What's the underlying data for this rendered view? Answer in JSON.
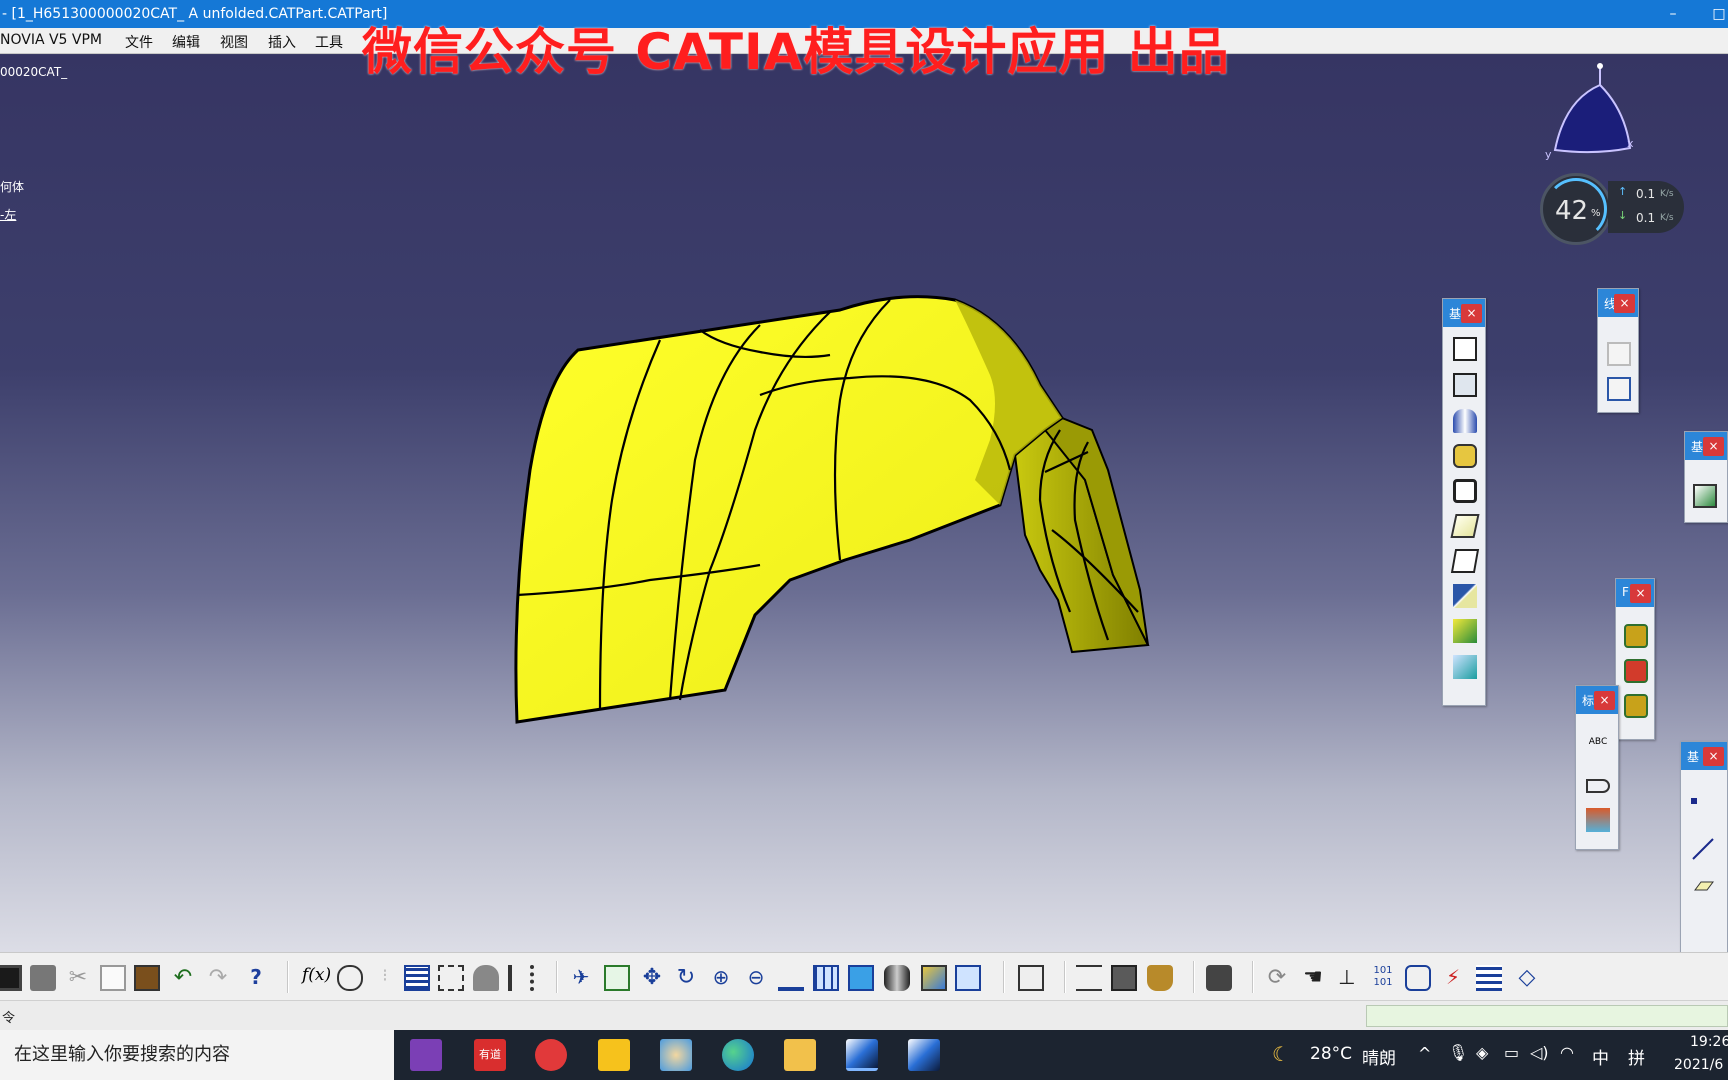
{
  "window": {
    "title": "- [1_H651300000020CAT_ A unfolded.CATPart.CATPart]",
    "minimize": "–",
    "maximize": "□"
  },
  "menu": {
    "items": [
      "NOVIA V5 VPM",
      "文件",
      "编辑",
      "视图",
      "插入",
      "工具"
    ]
  },
  "watermark": "微信公众号 CATIA模具设计应用 出品",
  "tree": {
    "root": "00020CAT_",
    "item1": "何体",
    "item2": "-左"
  },
  "speed_widget": {
    "percent": "42",
    "percent_unit": "%",
    "up": "0.1",
    "down": "0.1",
    "unit": "K/s"
  },
  "compass": {
    "x_label": "x",
    "y_label": "y",
    "z_label": "z"
  },
  "floating_toolbars": [
    {
      "title": "基",
      "close": "×"
    },
    {
      "title": "线",
      "close": "×"
    },
    {
      "title": "基",
      "close": "×"
    },
    {
      "title": "F",
      "close": "×"
    },
    {
      "title": "标",
      "close": "×"
    },
    {
      "title": "基",
      "close": "×"
    }
  ],
  "annot_icon_text": "ABC",
  "cmdline": {
    "label": "令"
  },
  "taskbar": {
    "search_placeholder": "在这里输入你要搜索的内容",
    "apps": [
      "onenote-icon",
      "youdao-icon",
      "iqiyi-icon",
      "sticky-notes-icon",
      "paint-icon",
      "edge-icon",
      "folder-icon",
      "catia-icon",
      "catia-icon"
    ],
    "youdao_label": "有道",
    "weather_temp": "28°C",
    "weather_text": "晴朗",
    "ime1": "中",
    "ime2": "拼",
    "time": "19:26",
    "date": "2021/6"
  },
  "colors": {
    "part_fill": "#f5f51c",
    "titlebar": "#1578d6",
    "watermark": "#ff1e1e",
    "toolbar_header": "#2c86d8",
    "close_button": "#d8393a"
  }
}
